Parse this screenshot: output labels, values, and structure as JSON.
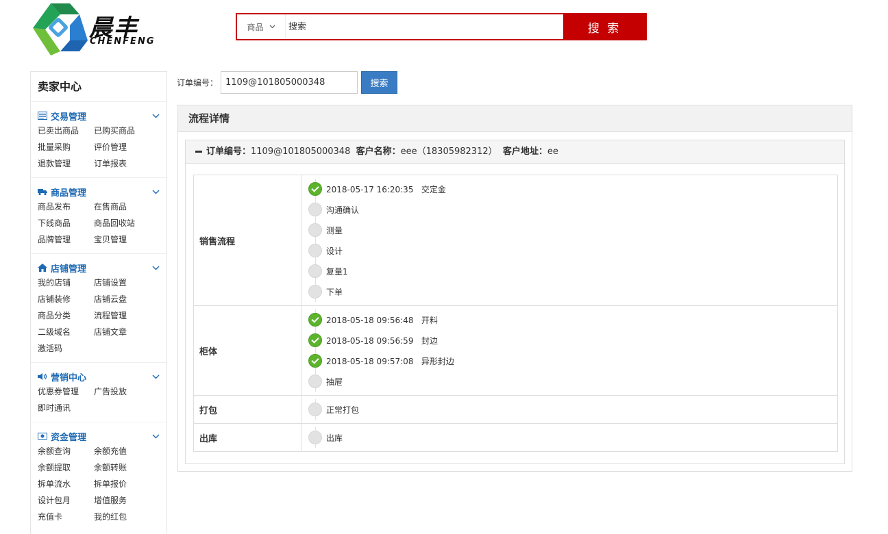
{
  "header": {
    "logo_cn": "晨丰",
    "logo_en": "CHENFENG",
    "search_category": "商品",
    "search_placeholder": "搜索",
    "search_button": "搜 索"
  },
  "sidebar": {
    "title": "卖家中心",
    "groups": [
      {
        "title": "交易管理",
        "icon": "list-icon",
        "items": [
          "已卖出商品",
          "已购买商品",
          "批量采购",
          "评价管理",
          "退款管理",
          "订单报表"
        ]
      },
      {
        "title": "商品管理",
        "icon": "truck-icon",
        "items": [
          "商品发布",
          "在售商品",
          "下线商品",
          "商品回收站",
          "品牌管理",
          "宝贝管理"
        ]
      },
      {
        "title": "店铺管理",
        "icon": "home-icon",
        "items": [
          "我的店铺",
          "店铺设置",
          "店铺装修",
          "店铺云盘",
          "商品分类",
          "流程管理",
          "二级域名",
          "店铺文章",
          "激活码"
        ]
      },
      {
        "title": "营销中心",
        "icon": "speaker-icon",
        "items": [
          "优惠券管理",
          "广告投放",
          "即时通讯"
        ]
      },
      {
        "title": "资金管理",
        "icon": "money-icon",
        "items": [
          "余额查询",
          "余额充值",
          "余额提取",
          "余额转账",
          "拆单流水",
          "拆单报价",
          "设计包月",
          "增值服务",
          "充值卡",
          "我的红包"
        ]
      }
    ]
  },
  "order_search": {
    "label": "订单编号：",
    "value": "1109@101805000348",
    "button": "搜索"
  },
  "panel": {
    "title": "流程详情",
    "sub_header": {
      "order_label": "订单编号：",
      "order_value": "1109@101805000348",
      "customer_label": "客户名称：",
      "customer_value": "eee（18305982312）",
      "address_label": "客户地址：",
      "address_value": "ee"
    },
    "stages": [
      {
        "name": "销售流程",
        "steps": [
          {
            "text": "2018-05-17 16:20:35   交定金",
            "done": true
          },
          {
            "text": "沟通确认",
            "done": false
          },
          {
            "text": "测量",
            "done": false
          },
          {
            "text": "设计",
            "done": false
          },
          {
            "text": "复量1",
            "done": false
          },
          {
            "text": "下单",
            "done": false
          }
        ]
      },
      {
        "name": "柜体",
        "steps": [
          {
            "text": "2018-05-18 09:56:48   开料",
            "done": true
          },
          {
            "text": "2018-05-18 09:56:59   封边",
            "done": true
          },
          {
            "text": "2018-05-18 09:57:08   异形封边",
            "done": true
          },
          {
            "text": "抽屉",
            "done": false
          }
        ]
      },
      {
        "name": "打包",
        "steps": [
          {
            "text": "正常打包",
            "done": false
          }
        ]
      },
      {
        "name": "出库",
        "steps": [
          {
            "text": "出库",
            "done": false
          }
        ]
      }
    ]
  },
  "colors": {
    "brand_red": "#c40000",
    "link_blue": "#1e6ab4",
    "button_blue": "#3a7cc4",
    "done_green": "#5cb32c"
  }
}
